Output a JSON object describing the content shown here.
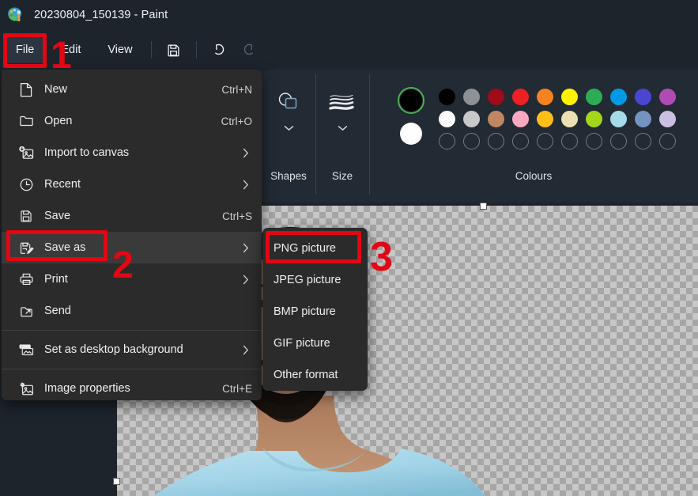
{
  "window": {
    "title": "20230804_150139 - Paint",
    "app_icon": "paint-palette-icon"
  },
  "menubar": {
    "items": [
      {
        "label": "File",
        "name": "file",
        "active": true
      },
      {
        "label": "Edit",
        "name": "edit",
        "active": false
      },
      {
        "label": "View",
        "name": "view",
        "active": false
      }
    ],
    "tools": [
      {
        "name": "save-icon",
        "title": "Save",
        "enabled": true
      },
      {
        "name": "undo-icon",
        "title": "Undo",
        "enabled": true
      },
      {
        "name": "redo-icon",
        "title": "Redo",
        "enabled": false
      }
    ]
  },
  "ribbon": {
    "shapes": {
      "label": "Shapes",
      "icon": "shapes-icon",
      "chevron": "chevron-down-icon"
    },
    "size": {
      "label": "Size",
      "icon": "brush-size-icon",
      "chevron": "chevron-down-icon"
    },
    "colours": {
      "label": "Colours",
      "primary": "#000000",
      "secondary": "#ffffff",
      "primary_selected": true,
      "selection_ring": "#4caf50",
      "palette_row1": [
        "#000000",
        "#8e9295",
        "#9e0b19",
        "#ed2024",
        "#f58220",
        "#fff200",
        "#2eac55",
        "#0099e5",
        "#4a46d0",
        "#b04bb4"
      ],
      "palette_row2": [
        "#ffffff",
        "#c6c8ca",
        "#c08763",
        "#f9a8c0",
        "#fbbf17",
        "#ecdfb2",
        "#a5d619",
        "#a5dbe8",
        "#7493c0",
        "#cbbfe3"
      ],
      "palette_row3_empty_count": 10
    }
  },
  "file_menu": {
    "items": [
      {
        "label": "New",
        "accel": "Ctrl+N",
        "icon": "new-file-icon",
        "arrow": false,
        "highlighted": false
      },
      {
        "label": "Open",
        "accel": "Ctrl+O",
        "icon": "folder-icon",
        "arrow": false,
        "highlighted": false
      },
      {
        "label": "Import to canvas",
        "accel": "",
        "icon": "import-image-icon",
        "arrow": true,
        "highlighted": false
      },
      {
        "label": "Recent",
        "accel": "",
        "icon": "clock-icon",
        "arrow": true,
        "highlighted": false
      },
      {
        "label": "Save",
        "accel": "Ctrl+S",
        "icon": "save-icon",
        "arrow": false,
        "highlighted": false
      },
      {
        "label": "Save as",
        "accel": "",
        "icon": "save-as-icon",
        "arrow": true,
        "highlighted": true
      },
      {
        "label": "Print",
        "accel": "",
        "icon": "printer-icon",
        "arrow": true,
        "highlighted": false
      },
      {
        "label": "Send",
        "accel": "",
        "icon": "send-icon",
        "arrow": false,
        "highlighted": false
      },
      {
        "separator_after": true,
        "label": "Set as desktop background",
        "accel": "",
        "icon": "desktop-background-icon",
        "arrow": true,
        "highlighted": false
      },
      {
        "label": "Image properties",
        "accel": "Ctrl+E",
        "icon": "image-properties-icon",
        "arrow": false,
        "highlighted": false
      }
    ]
  },
  "submenu": {
    "items": [
      {
        "label": "PNG picture"
      },
      {
        "label": "JPEG picture"
      },
      {
        "label": "BMP picture"
      },
      {
        "label": "GIF picture"
      },
      {
        "label": "Other format"
      }
    ]
  },
  "annotations": {
    "colour": "#e30613",
    "steps": [
      {
        "number": "1",
        "target": "File menu button"
      },
      {
        "number": "2",
        "target": "Save as menu item"
      },
      {
        "number": "3",
        "target": "PNG picture submenu item"
      }
    ]
  },
  "canvas": {
    "transparency_checker": true,
    "handles": [
      "top-center-handle",
      "left-bottom-handle"
    ],
    "content": "portrait-photo-background-removed"
  }
}
